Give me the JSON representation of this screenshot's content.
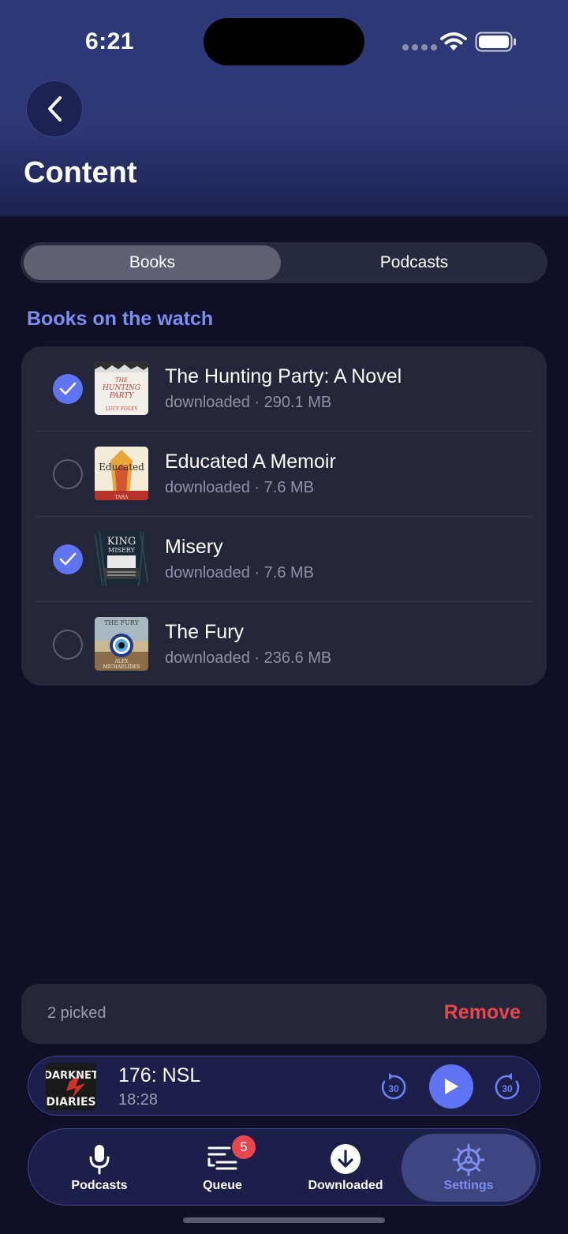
{
  "status_bar": {
    "time": "6:21"
  },
  "header": {
    "back_icon": "chevron-left-icon",
    "title": "Content"
  },
  "segmented": {
    "books_label": "Books",
    "podcasts_label": "Podcasts",
    "selected": "Books"
  },
  "section": {
    "title": "Books on the watch"
  },
  "books": [
    {
      "title": "The Hunting Party: A Novel",
      "meta": "downloaded · 290.1 MB",
      "checked": true
    },
    {
      "title": "Educated A Memoir",
      "meta": "downloaded · 7.6 MB",
      "checked": false
    },
    {
      "title": "Misery",
      "meta": "downloaded · 7.6 MB",
      "checked": true
    },
    {
      "title": "The Fury",
      "meta": "downloaded · 236.6 MB",
      "checked": false
    }
  ],
  "covers": {
    "hunting_party": {
      "line1": "THE",
      "line2": "HUNTING",
      "line3": "PARTY",
      "author": "LUCY FOLEY"
    },
    "educated": {
      "title": "Educated",
      "author": "TARA"
    },
    "misery": {
      "author": "KING",
      "title": "MISERY"
    },
    "fury": {
      "title": "THE FURY",
      "author1": "ALEX",
      "author2": "MICHAELIDES"
    }
  },
  "action_bar": {
    "picked_text": "2 picked",
    "remove_label": "Remove"
  },
  "mini_player": {
    "cover_line1": "DARKNET",
    "cover_line2": "DIARIES",
    "title": "176: NSL",
    "time": "18:28",
    "skip_back_seconds": "30",
    "skip_forward_seconds": "30"
  },
  "tabs": [
    {
      "label": "Podcasts",
      "icon": "microphone-icon"
    },
    {
      "label": "Queue",
      "icon": "queue-icon",
      "badge": "5"
    },
    {
      "label": "Downloaded",
      "icon": "download-icon"
    },
    {
      "label": "Settings",
      "icon": "gear-icon",
      "active": true
    }
  ],
  "colors": {
    "accent": "#5f74f2",
    "section_title": "#7f8cf0",
    "remove": "#e8454c",
    "background": "#0f1026"
  }
}
